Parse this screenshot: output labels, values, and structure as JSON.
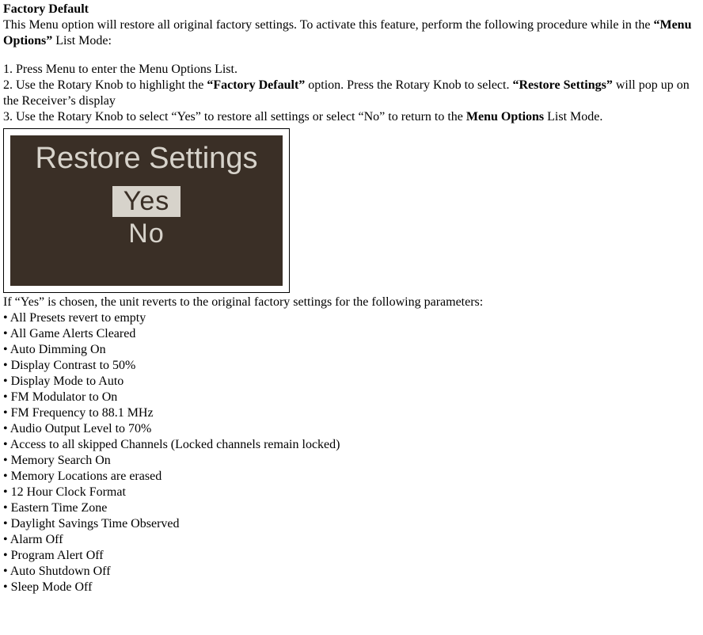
{
  "title": "Factory Default",
  "intro_pre": "This Menu option will restore all original factory settings. To activate this feature, perform the following procedure while in the ",
  "intro_bold": "“Menu Options”",
  "intro_post": " List Mode:",
  "step1": "1. Press Menu to enter the Menu Options List.",
  "step2_pre": "2. Use the Rotary Knob to highlight the ",
  "step2_b1": "“Factory Default”",
  "step2_mid": " option. Press the Rotary Knob to select. ",
  "step2_b2": "“Restore Settings”",
  "step2_post": " will pop up on the Receiver’s display",
  "step3_pre": "3. Use the Rotary Knob to select “Yes” to restore all settings or select “No” to return to the ",
  "step3_b": "Menu Options",
  "step3_post": " List Mode.",
  "lcd": {
    "title": "Restore Settings",
    "yes": "Yes",
    "no": "No"
  },
  "result_intro": "If “Yes” is chosen, the unit reverts to the original factory settings for the following parameters:",
  "bullets": {
    "b0": "• All Presets revert to empty",
    "b1": "• All Game Alerts Cleared",
    "b2": "• Auto Dimming On",
    "b3": "• Display Contrast to 50%",
    "b4": "• Display Mode to Auto",
    "b5": "• FM Modulator to On",
    "b6": "• FM Frequency to 88.1 MHz",
    "b7": "• Audio Output Level to 70%",
    "b8": "• Access to all skipped Channels (Locked channels remain locked)",
    "b9": "• Memory Search On",
    "b10": "• Memory Locations are erased",
    "b11": "• 12 Hour Clock Format",
    "b12": "• Eastern Time Zone",
    "b13": "• Daylight Savings Time Observed",
    "b14": "• Alarm Off",
    "b15": "• Program Alert Off",
    "b16": "• Auto Shutdown Off",
    "b17": "• Sleep Mode Off"
  }
}
